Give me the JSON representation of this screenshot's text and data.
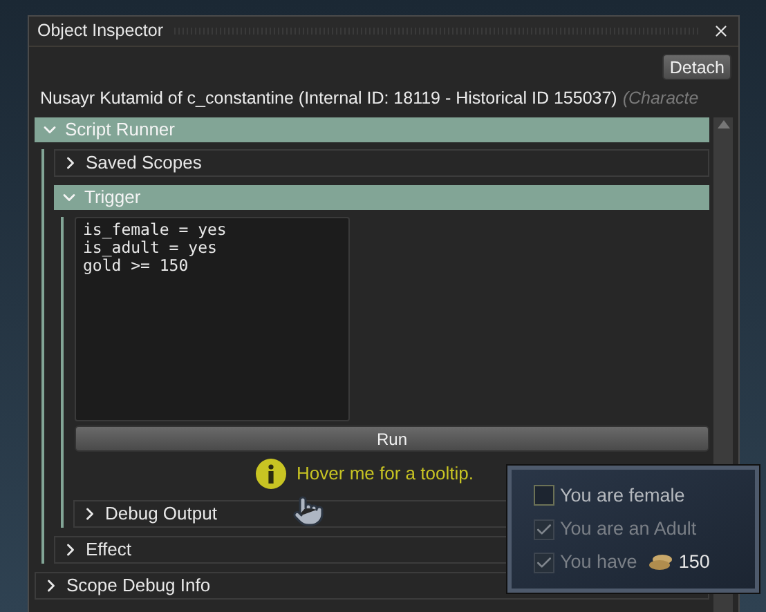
{
  "window": {
    "title": "Object Inspector"
  },
  "detach_button": "Detach",
  "object_name": "Nusayr Kutamid of c_constantine (Internal ID: 18119 - Historical ID 155037)",
  "object_type": "(Characte",
  "sections": [
    {
      "title": "Script Runner",
      "expanded": true,
      "children": [
        {
          "title": "Saved Scopes",
          "expanded": false
        },
        {
          "title": "Trigger",
          "expanded": true,
          "code": "is_female = yes\nis_adult = yes\ngold >= 150",
          "run_button": "Run",
          "hint": "Hover me for a tooltip.",
          "children": [
            {
              "title": "Debug Output",
              "expanded": false
            }
          ]
        },
        {
          "title": "Effect",
          "expanded": false
        }
      ]
    },
    {
      "title": "Scope Debug Info",
      "expanded": false
    }
  ],
  "tooltip": {
    "items": [
      {
        "label": "You are female",
        "checked": false
      },
      {
        "label": "You are an Adult",
        "checked": true
      },
      {
        "label": "You have",
        "checked": true,
        "amount": "150"
      }
    ]
  }
}
